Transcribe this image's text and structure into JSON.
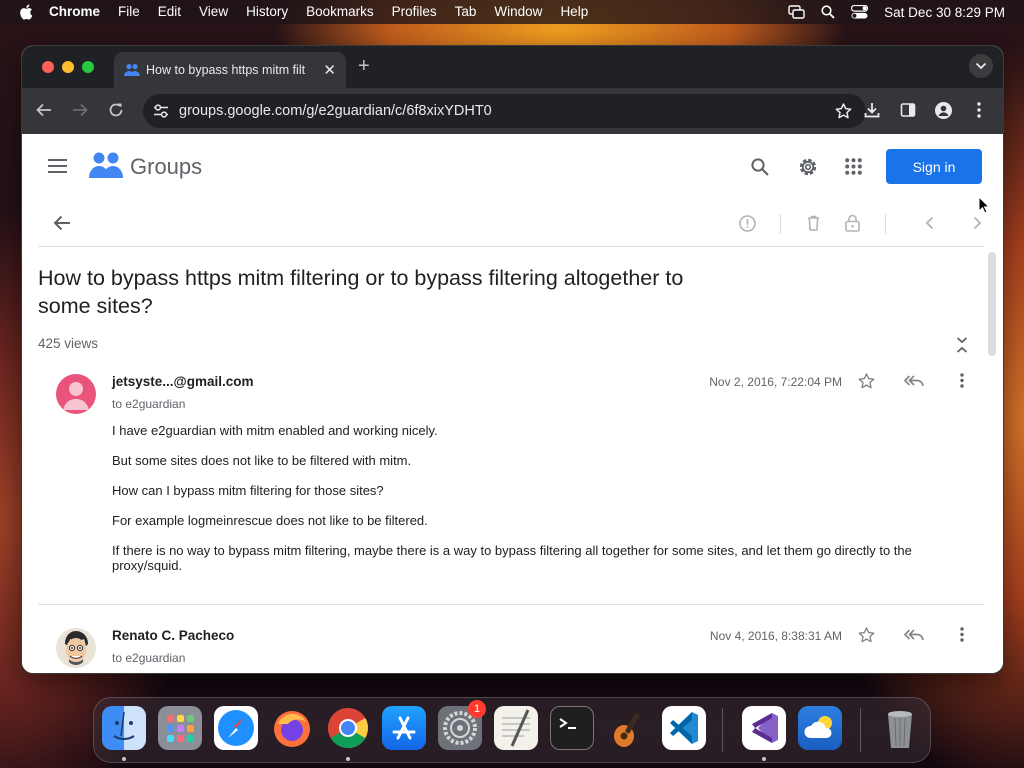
{
  "menubar": {
    "app": "Chrome",
    "items": [
      "File",
      "Edit",
      "View",
      "History",
      "Bookmarks",
      "Profiles",
      "Tab",
      "Window",
      "Help"
    ],
    "datetime": "Sat Dec 30  8:29 PM"
  },
  "browser": {
    "tab_title": "How to bypass https mitm filt",
    "url": "groups.google.com/g/e2guardian/c/6f8xixYDHT0"
  },
  "groups": {
    "logo_text": "Groups",
    "sign_in": "Sign in"
  },
  "thread": {
    "subject": "How to bypass https mitm filtering or to bypass filtering altogether to some sites?",
    "views": "425 views",
    "messages": [
      {
        "sender": "jetsyste...@gmail.com",
        "to": "to e2guardian",
        "date": "Nov 2, 2016, 7:22:04 PM",
        "body": [
          "I have e2guardian with mitm enabled and working nicely.",
          "But some sites does not like to be filtered with mitm.",
          "How can I bypass mitm filtering for those sites?",
          "For example logmeinrescue does not like to be filtered.",
          "If there is no way to bypass mitm filtering, maybe there is a way to bypass filtering all together for some sites, and let them go directly to the proxy/squid."
        ]
      },
      {
        "sender": "Renato C. Pacheco",
        "to": "to e2guardian",
        "date": "Nov 4, 2016, 8:38:31 AM"
      }
    ]
  },
  "dock": {
    "settings_badge": "1"
  },
  "colors": {
    "accent": "#1a73e8",
    "chrome_dark": "#202124",
    "toolbar": "#35363a"
  }
}
